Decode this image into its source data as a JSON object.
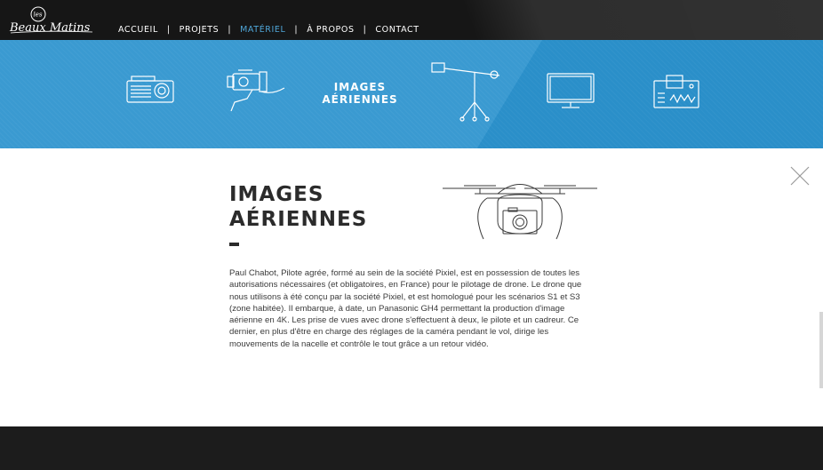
{
  "logo": {
    "text_top": "les",
    "text_main": "Beaux Matins"
  },
  "nav": {
    "items": [
      {
        "label": "ACCUEIL",
        "active": false
      },
      {
        "label": "PROJETS",
        "active": false
      },
      {
        "label": "MATÉRIEL",
        "active": true
      },
      {
        "label": "À PROPOS",
        "active": false
      },
      {
        "label": "CONTACT",
        "active": false
      }
    ],
    "separator": "|"
  },
  "equipment_band": {
    "icons": [
      "projector-icon",
      "camera-rig-icon",
      "crane-jib-icon",
      "monitor-icon",
      "mixing-console-icon"
    ],
    "active_title_line1": "IMAGES",
    "active_title_line2": "AÉRIENNES"
  },
  "content": {
    "title_line1": "IMAGES",
    "title_line2": "AÉRIENNES",
    "description": "Paul Chabot, Pilote agrée, formé au sein de la société Pixiel, est en possession de toutes les autorisations nécessaires (et obligatoires, en France) pour le pilotage de drone. Le drone que nous utilisons à été conçu par la société Pixiel, et est homologué pour les scénarios S1 et S3 (zone habitée). Il embarque, à date, un Panasonic GH4 permettant la production d'image aérienne en 4K. Les prise de vues avec drone s'effectuent à deux, le pilote et un cadreur. Ce dernier, en plus d'être en charge des réglages de la caméra pendant le vol, dirige les mouvements de la nacelle et contrôle le tout grâce a un retour vidéo.",
    "illustration": "drone-icon"
  },
  "colors": {
    "nav_bg": "#161616",
    "band_blue": "#2a8fc9",
    "active_nav": "#4fa6d8",
    "panel_bg": "#ffffff",
    "text_dark": "#2b2b2b"
  }
}
